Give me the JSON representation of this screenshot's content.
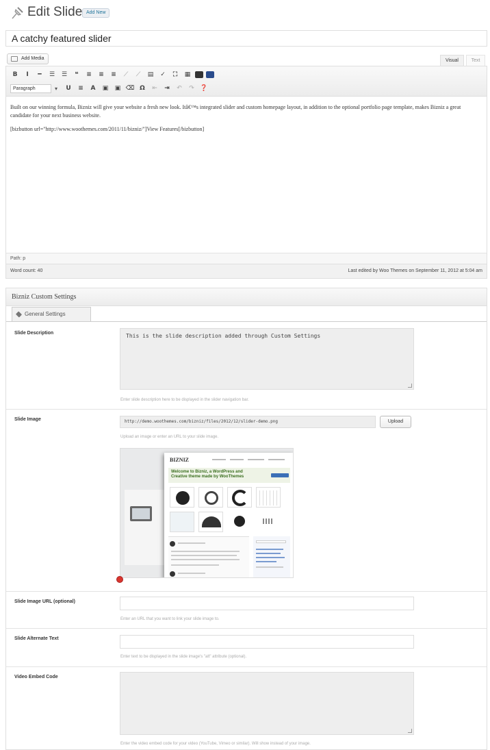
{
  "header": {
    "title": "Edit Slide",
    "add_new": "Add New",
    "icon": "pushpin-icon"
  },
  "post_title": "A catchy featured slider",
  "media": {
    "add_media": "Add Media"
  },
  "editor_tabs": {
    "visual": "Visual",
    "text": "Text"
  },
  "toolbar": {
    "row1": [
      {
        "name": "bold-icon",
        "glyph": "B"
      },
      {
        "name": "italic-icon",
        "glyph": "I"
      },
      {
        "name": "strikethrough-icon",
        "glyph": "━"
      },
      {
        "name": "bullet-list-icon",
        "glyph": "☰"
      },
      {
        "name": "numbered-list-icon",
        "glyph": "☰"
      },
      {
        "name": "blockquote-icon",
        "glyph": "❝"
      },
      {
        "name": "align-left-icon",
        "glyph": "≡"
      },
      {
        "name": "align-center-icon",
        "glyph": "≡"
      },
      {
        "name": "align-right-icon",
        "glyph": "≡"
      },
      {
        "name": "insert-link-icon",
        "glyph": "⟋",
        "dim": true
      },
      {
        "name": "unlink-icon",
        "glyph": "⟋",
        "dim": true
      },
      {
        "name": "read-more-icon",
        "glyph": "▤"
      },
      {
        "name": "spellcheck-icon",
        "glyph": "✓"
      },
      {
        "name": "fullscreen-icon",
        "glyph": "⛶"
      },
      {
        "name": "kitchen-sink-icon",
        "glyph": "▦"
      },
      {
        "name": "shortcode-icon",
        "block": true
      },
      {
        "name": "shortcode-blue-icon",
        "block": true,
        "blue": true
      }
    ],
    "paragraph_format": "Paragraph",
    "row2": [
      {
        "name": "underline-icon",
        "glyph": "U"
      },
      {
        "name": "justify-icon",
        "glyph": "≡"
      },
      {
        "name": "text-color-icon",
        "glyph": "A"
      },
      {
        "name": "paste-text-icon",
        "glyph": "▣"
      },
      {
        "name": "paste-word-icon",
        "glyph": "▣"
      },
      {
        "name": "clear-formatting-icon",
        "glyph": "⌫"
      },
      {
        "name": "special-character-icon",
        "glyph": "Ω"
      },
      {
        "name": "outdent-icon",
        "glyph": "⇤",
        "dim": true
      },
      {
        "name": "indent-icon",
        "glyph": "⇥"
      },
      {
        "name": "undo-icon",
        "glyph": "↶",
        "dim": true
      },
      {
        "name": "redo-icon",
        "glyph": "↷",
        "dim": true
      },
      {
        "name": "help-icon",
        "glyph": "❓"
      }
    ]
  },
  "content": {
    "paragraph1": "Built on our winning formula, Bizniz will give your website a fresh new look. Itâ€™s integrated slider and custom homepage layout, in addition to the optional portfolio page template, makes Bizniz a great candidate for your next business website.",
    "paragraph2": "[bizbutton url=\"http://www.woothemes.com/2011/11/bizniz/\"]View Features[/bizbutton]"
  },
  "status": {
    "path": "Path: p",
    "word_count": "Word count: 40",
    "last_edited": "Last edited by Woo Themes on September 11, 2012 at 5:04 am"
  },
  "custom_settings": {
    "title": "Bizniz Custom Settings",
    "tab": "General Settings",
    "fields": {
      "slide_description": {
        "label": "Slide Description",
        "value": "This is the slide description added through Custom Settings",
        "help": "Enter slide description here to be displayed in the slider navigation bar."
      },
      "slide_image": {
        "label": "Slide Image",
        "value": "http://demo.woothemes.com/bizniz/files/2012/12/slider-demo.png",
        "upload": "Upload",
        "help": "Upload an image or enter an URL to your slide image.",
        "preview": {
          "logo": "BIZNIZ",
          "tagline": "Welcome to Bizniz, a WordPress and Creative theme made by WooThemes"
        }
      },
      "slide_image_url": {
        "label": "Slide Image URL (optional)",
        "value": "",
        "help": "Enter an URL that you want to link your slide image to."
      },
      "slide_alt_text": {
        "label": "Slide Alternate Text",
        "value": "",
        "help": "Enter text to be displayed in the slide image's \"alt\" attribute (optional)."
      },
      "video_embed": {
        "label": "Video Embed Code",
        "value": "",
        "help": "Enter the video embed code for your video (YouTube, Vimeo or similar). Will show instead of your image."
      }
    }
  },
  "colors": {
    "link": "#21759b",
    "remove_dot": "#d9362f"
  }
}
